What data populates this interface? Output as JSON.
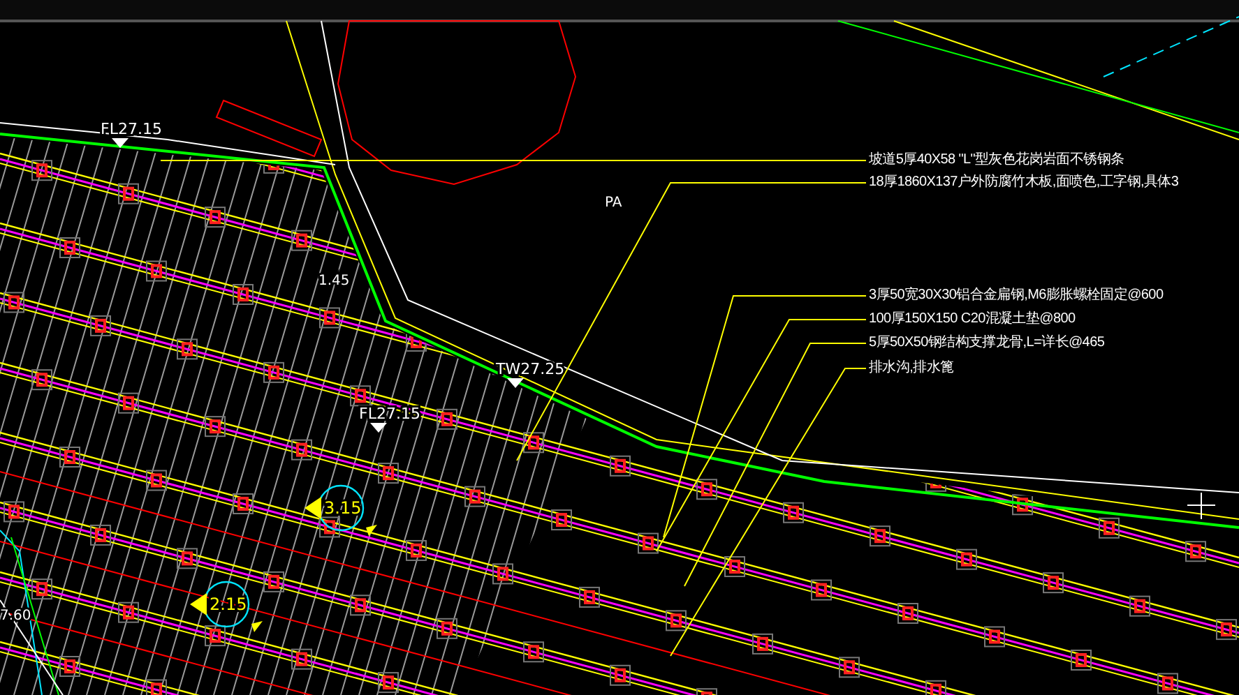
{
  "drawing": {
    "annotations": [
      "坡道5厚40X58 \"L\"型灰色花岗岩面不锈钢条",
      "18厚1860X137户外防腐竹木板,面喷色,工字钢,具体3",
      "3厚50宽30X30铝合金扁钢,M6膨胀螺栓固定@600",
      "100厚150X150 C20混凝土垫@800",
      "5厚50X50钢结构支撑龙骨,L=详长@465",
      "排水沟,排水篦"
    ],
    "labels": [
      {
        "text": "FL27.15",
        "kind": "elevation"
      },
      {
        "text": "TW27.25",
        "kind": "elevation"
      },
      {
        "text": "FL27.15",
        "kind": "elevation"
      },
      {
        "text": "PA",
        "kind": "plain"
      },
      {
        "text": "3.15",
        "kind": "circle"
      },
      {
        "text": "2.15",
        "kind": "circle"
      },
      {
        "text": "1.45",
        "kind": "plain"
      },
      {
        "text": "7.60",
        "kind": "plain"
      }
    ]
  }
}
